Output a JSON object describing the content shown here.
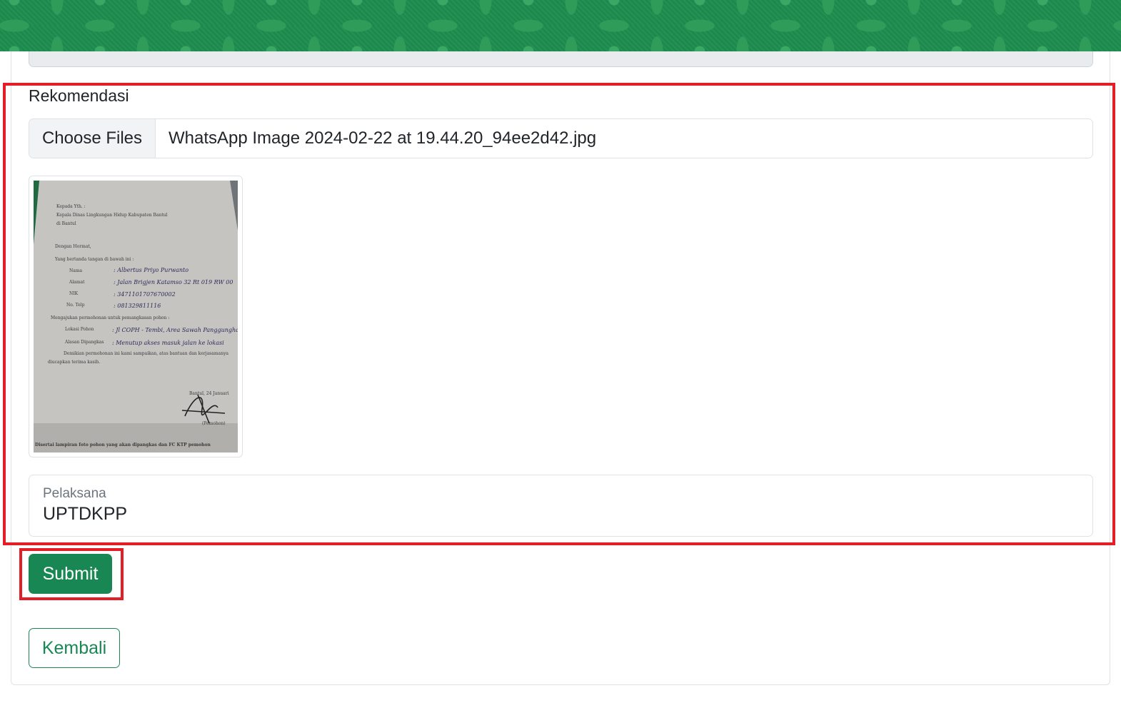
{
  "section": {
    "label": "Rekomendasi"
  },
  "file_input": {
    "button_label": "Choose Files",
    "file_name": "WhatsApp Image 2024-02-22 at 19.44.20_94ee2d42.jpg"
  },
  "preview": {
    "letter_lines": [
      "Kepada Yth. :",
      "Kepala Dinas Lingkungan Hidup Kabupaten Bantul",
      "di Bantul",
      "Dengan Hormat,",
      "Yang bertanda tangan di bawah ini :",
      "Nama",
      ": Albertus Priyo Purwanto",
      "Alamat",
      ": Jalan Brigjen Katamso 32 Rt 019 RW 00",
      "NIK",
      ": 3471101707670002",
      "No. Telp",
      ": 081329811116",
      "Mengajukan permohonan untuk pemangkasan pohon :",
      "Lokasi Pohon",
      ": Jl COPH - Tembi, Area Sawah Panggungharjo",
      "Alasan Dipangkas",
      ": Menutup akses masuk jalan ke lokasi",
      "Demikian permohonan ini kami sampaikan, atas bantuan dan kerjasamanya",
      "diucapkan terima kasih.",
      "Bantul, 24 Januari",
      "(Pemohon)",
      "Disertai lampiran foto pohon yang akan dipangkas dan FC KTP pemohon"
    ]
  },
  "pelaksana": {
    "label": "Pelaksana",
    "value": "UPTDKPP"
  },
  "actions": {
    "submit_label": "Submit",
    "back_label": "Kembali"
  },
  "colors": {
    "primary_green": "#198754",
    "highlight_red": "#e41e26",
    "header_green": "#1b8a4c"
  }
}
